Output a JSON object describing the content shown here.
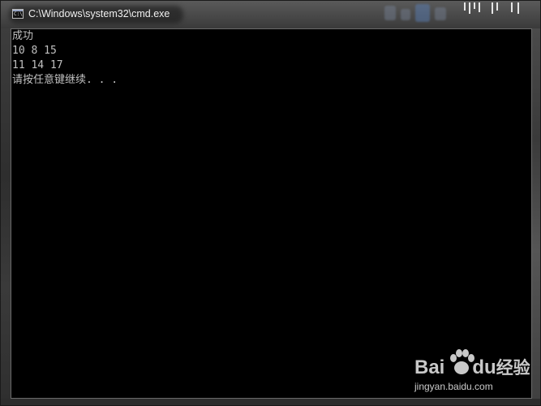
{
  "window": {
    "title": "C:\\Windows\\system32\\cmd.exe",
    "icon_label": "C:\\"
  },
  "console": {
    "lines": [
      "成功",
      "10 8 15",
      "11 14 17",
      "请按任意键继续. . ."
    ]
  },
  "watermark": {
    "brand_left": "Bai",
    "brand_right": "du",
    "brand_suffix": "经验",
    "url": "jingyan.baidu.com"
  },
  "colors": {
    "console_bg": "#000000",
    "console_text": "#c0c0c0",
    "title_text": "#f0f0f0"
  }
}
